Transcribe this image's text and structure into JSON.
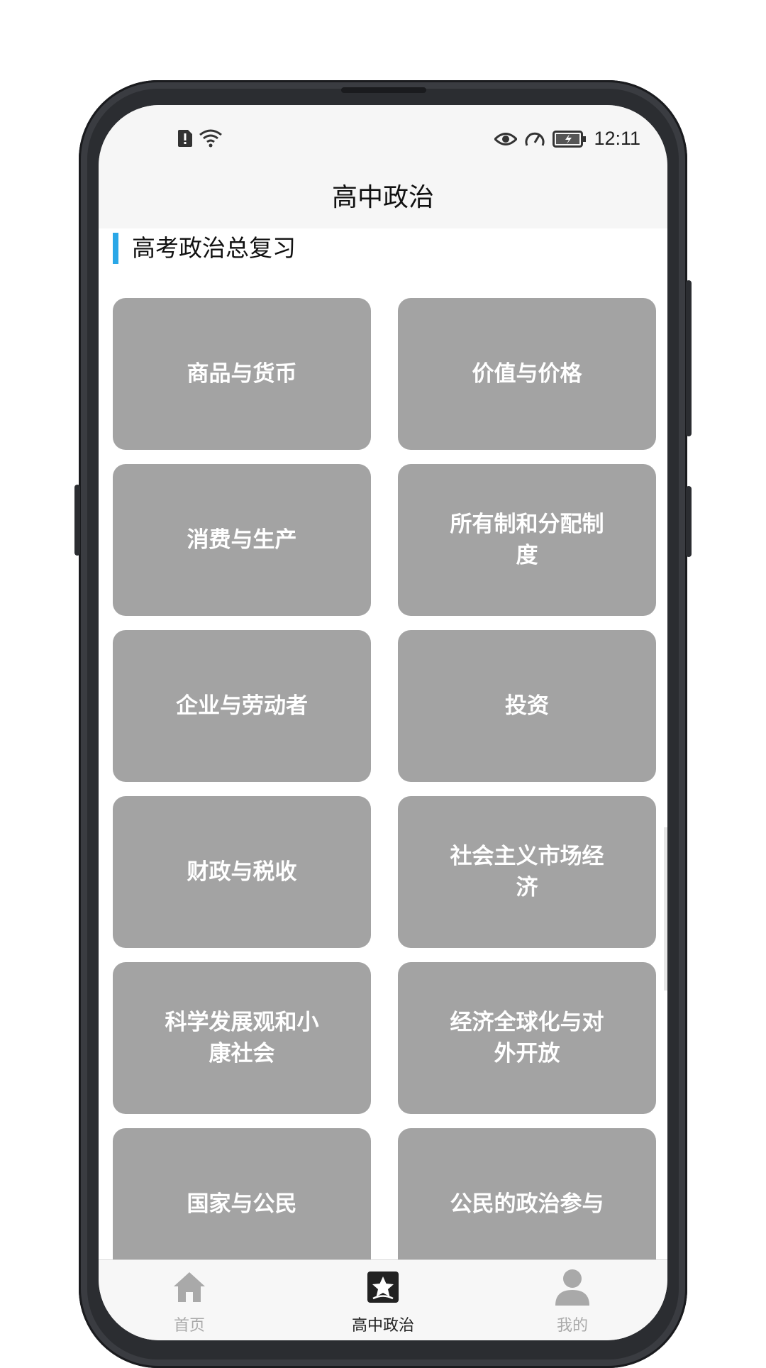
{
  "status_bar": {
    "time": "12:11"
  },
  "header": {
    "title": "高中政治"
  },
  "section": {
    "title": "高考政治总复习"
  },
  "topics": [
    "商品与货币",
    "价值与价格",
    "消费与生产",
    "所有制和分配制度",
    "企业与劳动者",
    "投资",
    "财政与税收",
    "社会主义市场经济",
    "科学发展观和小康社会",
    "经济全球化与对外开放",
    "国家与公民",
    "公民的政治参与"
  ],
  "tabs": [
    {
      "label": "首页",
      "icon": "home-icon",
      "active": false
    },
    {
      "label": "高中政治",
      "icon": "star-icon",
      "active": true
    },
    {
      "label": "我的",
      "icon": "person-icon",
      "active": false
    }
  ],
  "colors": {
    "accent": "#2aa7e7",
    "tile": "#a3a3a3",
    "tab_inactive": "#a9a9a9",
    "tab_active": "#222222"
  }
}
